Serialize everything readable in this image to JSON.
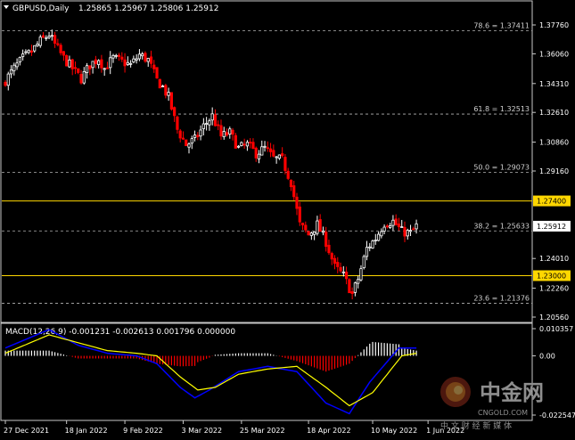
{
  "header": {
    "symbol": "GBPUSD,Daily",
    "ohlc": "1.25865 1.25967 1.25806 1.25912"
  },
  "price_axis": {
    "ticks": [
      "1.37760",
      "1.36060",
      "1.34310",
      "1.32610",
      "1.30860",
      "1.29160",
      "1.24010",
      "1.22260",
      "1.20560"
    ],
    "price_tag": "1.25912",
    "level_tags": [
      "1.27400",
      "1.23000"
    ]
  },
  "fib_levels": [
    {
      "label": "78.6 = 1.37411",
      "price": 1.37411
    },
    {
      "label": "61.8 = 1.32513",
      "price": 1.32513
    },
    {
      "label": "50.0 = 1.29073",
      "price": 1.29073
    },
    {
      "label": "38.2 = 1.25633",
      "price": 1.25633
    },
    {
      "label": "23.6 = 1.21376",
      "price": 1.21376
    }
  ],
  "horizontal_lines": [
    1.274,
    1.23
  ],
  "macd": {
    "label": "MACD(12,26,9) -0.001231 -0.002613 0.001796 0.000000",
    "ticks": [
      "0.010357",
      "0.00",
      "-0.022547"
    ]
  },
  "time_axis": [
    "27 Dec 2021",
    "18 Jan 2022",
    "9 Feb 2022",
    "3 Mar 2022",
    "25 Mar 2022",
    "18 Apr 2022",
    "10 May 2022",
    "1 Jun 2022"
  ],
  "watermark": {
    "brand": "中金网",
    "sub": "CNGOLD.COM",
    "cn": "中 文 财 经 新 媒 体"
  },
  "colors": {
    "up": "#ffffff",
    "down": "#ff0000",
    "level_line": "#ffd700",
    "fib_line": "#b4b4b4",
    "macd_main": "#0000ff",
    "macd_signal": "#ffff00"
  },
  "chart_data": {
    "type": "candlestick",
    "timeframe": "Daily",
    "x": [
      "2021-12-27",
      "2022-01-18",
      "2022-02-09",
      "2022-03-03",
      "2022-03-25",
      "2022-04-18",
      "2022-05-10",
      "2022-06-01"
    ],
    "ylim": [
      1.2006,
      1.3826
    ],
    "close_path": [
      [
        0,
        1.345
      ],
      [
        3,
        1.352
      ],
      [
        6,
        1.358
      ],
      [
        9,
        1.362
      ],
      [
        12,
        1.368
      ],
      [
        15,
        1.372
      ],
      [
        17,
        1.366
      ],
      [
        20,
        1.358
      ],
      [
        23,
        1.352
      ],
      [
        26,
        1.346
      ],
      [
        29,
        1.354
      ],
      [
        32,
        1.358
      ],
      [
        34,
        1.352
      ],
      [
        37,
        1.358
      ],
      [
        40,
        1.356
      ],
      [
        43,
        1.354
      ],
      [
        46,
        1.36
      ],
      [
        49,
        1.357
      ],
      [
        52,
        1.345
      ],
      [
        54,
        1.341
      ],
      [
        56,
        1.335
      ],
      [
        59,
        1.316
      ],
      [
        62,
        1.307
      ],
      [
        65,
        1.31
      ],
      [
        68,
        1.318
      ],
      [
        71,
        1.324
      ],
      [
        74,
        1.312
      ],
      [
        77,
        1.314
      ],
      [
        80,
        1.305
      ],
      [
        83,
        1.307
      ],
      [
        86,
        1.302
      ],
      [
        89,
        1.305
      ],
      [
        92,
        1.299
      ],
      [
        95,
        1.298
      ],
      [
        98,
        1.285
      ],
      [
        101,
        1.26
      ],
      [
        104,
        1.254
      ],
      [
        107,
        1.26
      ],
      [
        110,
        1.25
      ],
      [
        113,
        1.235
      ],
      [
        116,
        1.23
      ],
      [
        119,
        1.219
      ],
      [
        121,
        1.228
      ],
      [
        124,
        1.246
      ],
      [
        127,
        1.252
      ],
      [
        130,
        1.261
      ],
      [
        133,
        1.262
      ],
      [
        136,
        1.256
      ],
      [
        139,
        1.255
      ],
      [
        141,
        1.2591
      ]
    ],
    "macd_path": [
      [
        0,
        0.003
      ],
      [
        15,
        0.01
      ],
      [
        25,
        0.004
      ],
      [
        35,
        0.001
      ],
      [
        45,
        0.0
      ],
      [
        52,
        -0.003
      ],
      [
        60,
        -0.012
      ],
      [
        65,
        -0.016
      ],
      [
        70,
        -0.013
      ],
      [
        80,
        -0.006
      ],
      [
        90,
        -0.004
      ],
      [
        100,
        -0.006
      ],
      [
        110,
        -0.018
      ],
      [
        118,
        -0.022
      ],
      [
        125,
        -0.01
      ],
      [
        135,
        0.003
      ],
      [
        141,
        0.003
      ]
    ],
    "signal_path": [
      [
        0,
        0.001
      ],
      [
        15,
        0.008
      ],
      [
        25,
        0.005
      ],
      [
        35,
        0.002
      ],
      [
        45,
        0.001
      ],
      [
        52,
        0.0
      ],
      [
        60,
        -0.008
      ],
      [
        66,
        -0.013
      ],
      [
        72,
        -0.012
      ],
      [
        80,
        -0.007
      ],
      [
        90,
        -0.005
      ],
      [
        100,
        -0.004
      ],
      [
        110,
        -0.012
      ],
      [
        118,
        -0.019
      ],
      [
        126,
        -0.014
      ],
      [
        136,
        0.0
      ],
      [
        141,
        0.001
      ]
    ]
  }
}
